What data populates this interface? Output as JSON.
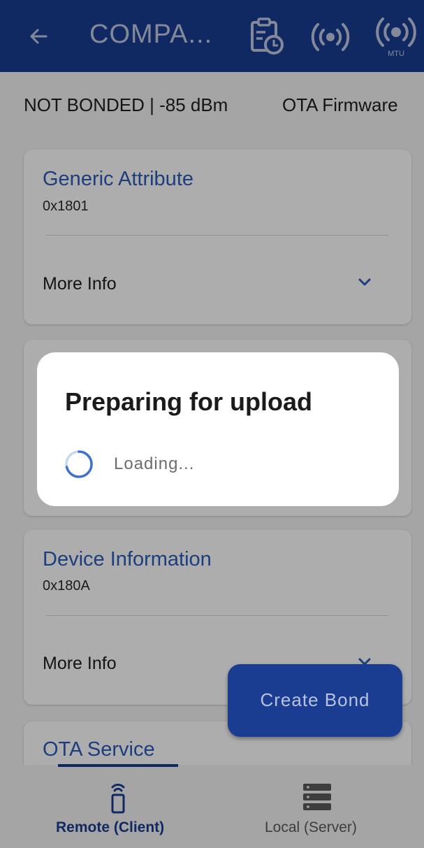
{
  "app_bar": {
    "title": "COMPA...",
    "background": "#1a3d91",
    "icons": [
      "back-arrow-icon",
      "log-history-icon",
      "rssi-signal-icon",
      "mtu-icon"
    ],
    "mtu_badge": "MTU"
  },
  "status_bar": {
    "bond_status": "NOT BONDED | -85 dBm",
    "ota_button": "OTA Firmware"
  },
  "services": [
    {
      "name": "Generic Attribute",
      "uuid": "0x1801",
      "more_info": "More Info"
    },
    {
      "name": "Device Information",
      "uuid": "0x180A",
      "more_info": "More Info"
    },
    {
      "name": "OTA Service"
    }
  ],
  "fab": {
    "label": "Create Bond"
  },
  "dialog": {
    "title": "Preparing for upload",
    "message": "Loading..."
  },
  "bottom_nav": {
    "items": [
      {
        "label": "Remote (Client)",
        "icon": "remote-icon",
        "active": true
      },
      {
        "label": "Local (Server)",
        "icon": "server-icon",
        "active": false
      }
    ],
    "active_color": "#1a3d91"
  }
}
